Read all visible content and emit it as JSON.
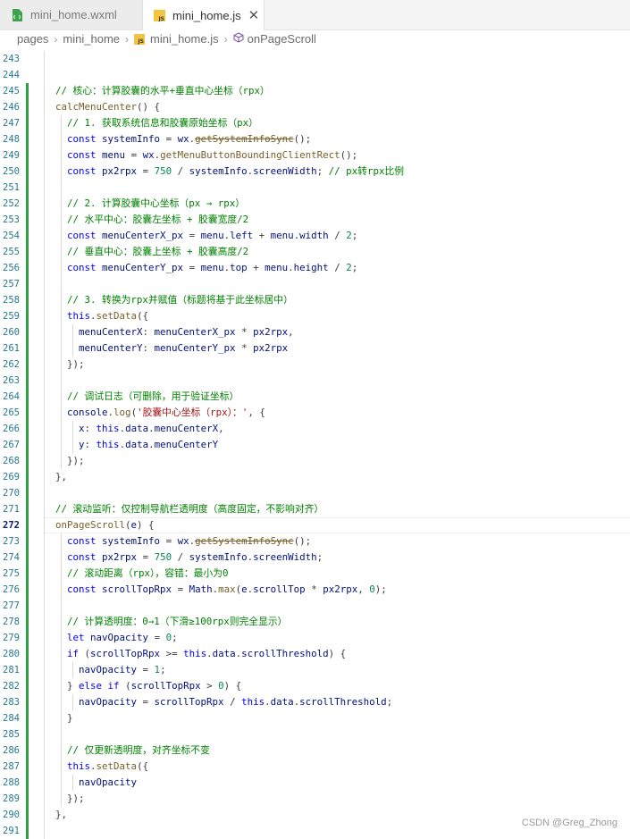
{
  "tabs": [
    {
      "label": "mini_home.wxml",
      "icon": "wxml-file-icon",
      "active": false
    },
    {
      "label": "mini_home.js",
      "icon": "js-file-icon",
      "active": true,
      "close": "✕"
    }
  ],
  "breadcrumb": {
    "items": [
      "pages",
      "mini_home",
      "mini_home.js",
      "onPageScroll"
    ],
    "separator": "›"
  },
  "editor": {
    "current_line": 272,
    "lines": [
      {
        "n": "243",
        "t": ""
      },
      {
        "n": "244",
        "t": ""
      },
      {
        "n": "245",
        "t": "// 核心：计算胶囊的水平+垂直中心坐标（rpx）"
      },
      {
        "n": "246",
        "t": "calcMenuCenter() {"
      },
      {
        "n": "247",
        "t": "  // 1. 获取系统信息和胶囊原始坐标（px）"
      },
      {
        "n": "248",
        "t": "  const systemInfo = wx.getSystemInfoSync();"
      },
      {
        "n": "249",
        "t": "  const menu = wx.getMenuButtonBoundingClientRect();"
      },
      {
        "n": "250",
        "t": "  const px2rpx = 750 / systemInfo.screenWidth; // px转rpx比例"
      },
      {
        "n": "251",
        "t": ""
      },
      {
        "n": "252",
        "t": "  // 2. 计算胶囊中心坐标（px → rpx）"
      },
      {
        "n": "253",
        "t": "  // 水平中心：胶囊左坐标 + 胶囊宽度/2"
      },
      {
        "n": "254",
        "t": "  const menuCenterX_px = menu.left + menu.width / 2;"
      },
      {
        "n": "255",
        "t": "  // 垂直中心：胶囊上坐标 + 胶囊高度/2"
      },
      {
        "n": "256",
        "t": "  const menuCenterY_px = menu.top + menu.height / 2;"
      },
      {
        "n": "257",
        "t": ""
      },
      {
        "n": "258",
        "t": "  // 3. 转换为rpx并赋值（标题将基于此坐标居中）"
      },
      {
        "n": "259",
        "t": "  this.setData({"
      },
      {
        "n": "260",
        "t": "    menuCenterX: menuCenterX_px * px2rpx,"
      },
      {
        "n": "261",
        "t": "    menuCenterY: menuCenterY_px * px2rpx"
      },
      {
        "n": "262",
        "t": "  });"
      },
      {
        "n": "263",
        "t": ""
      },
      {
        "n": "264",
        "t": "  // 调试日志（可删除，用于验证坐标）"
      },
      {
        "n": "265",
        "t": "  console.log('胶囊中心坐标（rpx）：', {"
      },
      {
        "n": "266",
        "t": "    x: this.data.menuCenterX,"
      },
      {
        "n": "267",
        "t": "    y: this.data.menuCenterY"
      },
      {
        "n": "268",
        "t": "  });"
      },
      {
        "n": "269",
        "t": "},"
      },
      {
        "n": "270",
        "t": ""
      },
      {
        "n": "271",
        "t": "// 滚动监听：仅控制导航栏透明度（高度固定，不影响对齐）"
      },
      {
        "n": "272",
        "t": "onPageScroll(e) {"
      },
      {
        "n": "273",
        "t": "  const systemInfo = wx.getSystemInfoSync();"
      },
      {
        "n": "274",
        "t": "  const px2rpx = 750 / systemInfo.screenWidth;"
      },
      {
        "n": "275",
        "t": "  // 滚动距离（rpx），容错：最小为0"
      },
      {
        "n": "276",
        "t": "  const scrollTopRpx = Math.max(e.scrollTop * px2rpx, 0);"
      },
      {
        "n": "277",
        "t": ""
      },
      {
        "n": "278",
        "t": "  // 计算透明度：0→1（下滑≥100rpx则完全显示）"
      },
      {
        "n": "279",
        "t": "  let navOpacity = 0;"
      },
      {
        "n": "280",
        "t": "  if (scrollTopRpx >= this.data.scrollThreshold) {"
      },
      {
        "n": "281",
        "t": "    navOpacity = 1;"
      },
      {
        "n": "282",
        "t": "  } else if (scrollTopRpx > 0) {"
      },
      {
        "n": "283",
        "t": "    navOpacity = scrollTopRpx / this.data.scrollThreshold;"
      },
      {
        "n": "284",
        "t": "  }"
      },
      {
        "n": "285",
        "t": ""
      },
      {
        "n": "286",
        "t": "  // 仅更新透明度，对齐坐标不变"
      },
      {
        "n": "287",
        "t": "  this.setData({"
      },
      {
        "n": "288",
        "t": "    navOpacity"
      },
      {
        "n": "289",
        "t": "  });"
      },
      {
        "n": "290",
        "t": "},"
      },
      {
        "n": "291",
        "t": ""
      }
    ]
  },
  "watermark": "CSDN @Greg_Zhong"
}
